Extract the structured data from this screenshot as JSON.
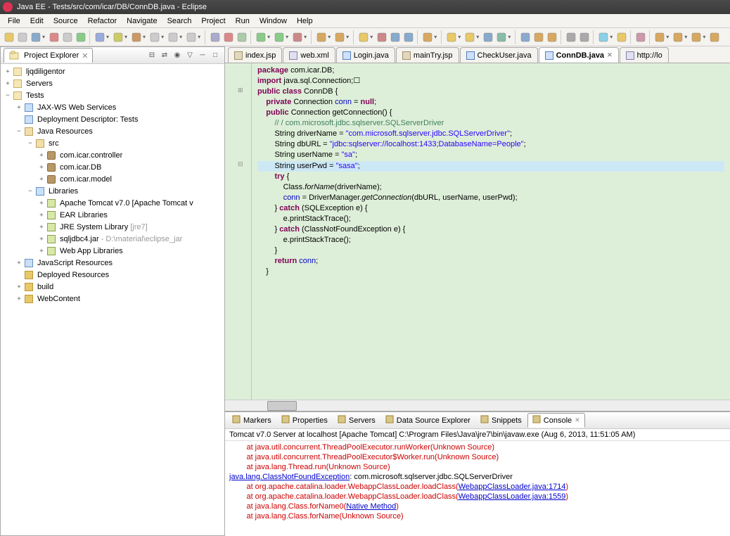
{
  "title": "Java EE - Tests/src/com/icar/DB/ConnDB.java - Eclipse",
  "menu": [
    "File",
    "Edit",
    "Source",
    "Refactor",
    "Navigate",
    "Search",
    "Project",
    "Run",
    "Window",
    "Help"
  ],
  "sidebar": {
    "title": "Project Explorer",
    "nodes": [
      {
        "indent": 0,
        "tw": "+",
        "icon": "proj",
        "label": "ljqdiligentor"
      },
      {
        "indent": 0,
        "tw": "+",
        "icon": "proj",
        "label": "Servers"
      },
      {
        "indent": 0,
        "tw": "−",
        "icon": "proj",
        "label": "Tests"
      },
      {
        "indent": 1,
        "tw": "+",
        "icon": "lib",
        "label": "JAX-WS Web Services"
      },
      {
        "indent": 1,
        "tw": "",
        "icon": "lib",
        "label": "Deployment Descriptor: Tests"
      },
      {
        "indent": 1,
        "tw": "−",
        "icon": "src",
        "label": "Java Resources"
      },
      {
        "indent": 2,
        "tw": "−",
        "icon": "src",
        "label": "src"
      },
      {
        "indent": 3,
        "tw": "+",
        "icon": "pkg",
        "label": "com.icar.controller"
      },
      {
        "indent": 3,
        "tw": "+",
        "icon": "pkg",
        "label": "com.icar.DB"
      },
      {
        "indent": 3,
        "tw": "+",
        "icon": "pkg",
        "label": "com.icar.model"
      },
      {
        "indent": 2,
        "tw": "−",
        "icon": "lib",
        "label": "Libraries"
      },
      {
        "indent": 3,
        "tw": "+",
        "icon": "jar",
        "label": "Apache Tomcat v7.0 [Apache Tomcat v"
      },
      {
        "indent": 3,
        "tw": "+",
        "icon": "jar",
        "label": "EAR Libraries"
      },
      {
        "indent": 3,
        "tw": "+",
        "icon": "jar",
        "label": "JRE System Library ",
        "gray": "[jre7]"
      },
      {
        "indent": 3,
        "tw": "+",
        "icon": "jar",
        "label": "sqljdbc4.jar ",
        "gray": "- D:\\material\\eclipse_jar"
      },
      {
        "indent": 3,
        "tw": "+",
        "icon": "jar",
        "label": "Web App Libraries"
      },
      {
        "indent": 1,
        "tw": "+",
        "icon": "lib",
        "label": "JavaScript Resources"
      },
      {
        "indent": 1,
        "tw": "",
        "icon": "folder",
        "label": "Deployed Resources"
      },
      {
        "indent": 1,
        "tw": "+",
        "icon": "folder",
        "label": "build"
      },
      {
        "indent": 1,
        "tw": "+",
        "icon": "folder",
        "label": "WebContent"
      }
    ]
  },
  "editorTabs": [
    {
      "icon": "jsp",
      "label": "index.jsp"
    },
    {
      "icon": "xml",
      "label": "web.xml"
    },
    {
      "icon": "java",
      "label": "Login.java"
    },
    {
      "icon": "jsp",
      "label": "mainTry.jsp"
    },
    {
      "icon": "java",
      "label": "CheckUser.java"
    },
    {
      "icon": "java",
      "label": "ConnDB.java",
      "active": true,
      "close": true
    },
    {
      "icon": "xml",
      "label": "http://lo"
    }
  ],
  "code": [
    [
      {
        "t": "package ",
        "c": "kw"
      },
      {
        "t": "com.icar.DB;"
      }
    ],
    [
      {
        "t": ""
      }
    ],
    [
      {
        "t": "import ",
        "c": "kw"
      },
      {
        "t": "java.sql.Connection;"
      },
      {
        "t": "☐",
        "c": "gray"
      }
    ],
    [
      {
        "t": ""
      }
    ],
    [
      {
        "t": "public class ",
        "c": "kw"
      },
      {
        "t": "ConnDB {"
      }
    ],
    [
      {
        "t": ""
      }
    ],
    [
      {
        "t": "    "
      },
      {
        "t": "private ",
        "c": "kw"
      },
      {
        "t": "Connection "
      },
      {
        "t": "conn",
        "c": "fld"
      },
      {
        "t": " = "
      },
      {
        "t": "null",
        "c": "kw"
      },
      {
        "t": ";"
      }
    ],
    [
      {
        "t": ""
      }
    ],
    [
      {
        "t": ""
      }
    ],
    [
      {
        "t": "    "
      },
      {
        "t": "public ",
        "c": "kw"
      },
      {
        "t": "Connection getConnection() {"
      }
    ],
    [
      {
        "t": "        "
      },
      {
        "t": "// / com.microsoft.jdbc.sqlserver.SQLServerDriver",
        "c": "cm"
      }
    ],
    [
      {
        "t": "        String driverName = "
      },
      {
        "t": "\"com.microsoft.sqlserver.jdbc.SQLServerDriver\"",
        "c": "str"
      },
      {
        "t": ";"
      }
    ],
    [
      {
        "t": "        String dbURL = "
      },
      {
        "t": "\"jdbc:sqlserver://localhost:1433;DatabaseName=People\"",
        "c": "str"
      },
      {
        "t": ";"
      }
    ],
    [
      {
        "t": "        String userName = "
      },
      {
        "t": "\"sa\"",
        "c": "str"
      },
      {
        "t": ";"
      }
    ],
    [
      {
        "t": "        String userPwd = "
      },
      {
        "t": "\"sasa\"",
        "c": "str"
      },
      {
        "t": ";"
      },
      {
        "hl": true
      }
    ],
    [
      {
        "t": ""
      }
    ],
    [
      {
        "t": "        "
      },
      {
        "t": "try ",
        "c": "kw"
      },
      {
        "t": "{"
      }
    ],
    [
      {
        "t": "            Class."
      },
      {
        "t": "forName",
        "c": "it"
      },
      {
        "t": "(driverName);"
      }
    ],
    [
      {
        "t": "            "
      },
      {
        "t": "conn",
        "c": "fld"
      },
      {
        "t": " = DriverManager."
      },
      {
        "t": "getConnection",
        "c": "it"
      },
      {
        "t": "(dbURL, userName, userPwd);"
      }
    ],
    [
      {
        "t": ""
      }
    ],
    [
      {
        "t": "        } "
      },
      {
        "t": "catch ",
        "c": "kw"
      },
      {
        "t": "(SQLException e) {"
      }
    ],
    [
      {
        "t": "            e.printStackTrace();"
      }
    ],
    [
      {
        "t": "        } "
      },
      {
        "t": "catch ",
        "c": "kw"
      },
      {
        "t": "(ClassNotFoundException e) {"
      }
    ],
    [
      {
        "t": "            e.printStackTrace();"
      }
    ],
    [
      {
        "t": "        }"
      }
    ],
    [
      {
        "t": ""
      }
    ],
    [
      {
        "t": "        "
      },
      {
        "t": "return ",
        "c": "kw"
      },
      {
        "t": "conn",
        "c": "fld"
      },
      {
        "t": ";"
      }
    ],
    [
      {
        "t": ""
      }
    ],
    [
      {
        "t": "    }"
      }
    ]
  ],
  "gutterMarks": [
    {
      "line": 2,
      "mark": "+"
    },
    {
      "line": 9,
      "mark": "−"
    }
  ],
  "bottomTabs": [
    {
      "label": "Markers"
    },
    {
      "label": "Properties"
    },
    {
      "label": "Servers"
    },
    {
      "label": "Data Source Explorer"
    },
    {
      "label": "Snippets"
    },
    {
      "label": "Console",
      "active": true,
      "close": true
    }
  ],
  "consoleHeader": "Tomcat v7.0 Server at localhost [Apache Tomcat] C:\\Program Files\\Java\\jre7\\bin\\javaw.exe (Aug 6, 2013, 11:51:05 AM)",
  "consoleLines": [
    [
      {
        "t": "        at java.util.concurrent.ThreadPoolExecutor.runWorker(Unknown Source)",
        "c": "err"
      }
    ],
    [
      {
        "t": "        at java.util.concurrent.ThreadPoolExecutor$Worker.run(Unknown Source)",
        "c": "err"
      }
    ],
    [
      {
        "t": "        at java.lang.Thread.run(Unknown Source)",
        "c": "err"
      }
    ],
    [
      {
        "t": "java.lang.ClassNotFoundException",
        "c": "lnk"
      },
      {
        "t": ": com.microsoft.sqlserver.jdbc.SQLServerDriver"
      }
    ],
    [
      {
        "t": "        at org.apache.catalina.loader.WebappClassLoader.loadClass(",
        "c": "err"
      },
      {
        "t": "WebappClassLoader.java:1714",
        "c": "lnk"
      },
      {
        "t": ")",
        "c": "err"
      }
    ],
    [
      {
        "t": "        at org.apache.catalina.loader.WebappClassLoader.loadClass(",
        "c": "err"
      },
      {
        "t": "WebappClassLoader.java:1559",
        "c": "lnk"
      },
      {
        "t": ")",
        "c": "err"
      }
    ],
    [
      {
        "t": "        at java.lang.Class.forName0(",
        "c": "err"
      },
      {
        "t": "Native Method",
        "c": "lnk"
      },
      {
        "t": ")",
        "c": "err"
      }
    ],
    [
      {
        "t": "        at java.lang.Class.forName(Unknown Source)",
        "c": "err"
      }
    ]
  ]
}
